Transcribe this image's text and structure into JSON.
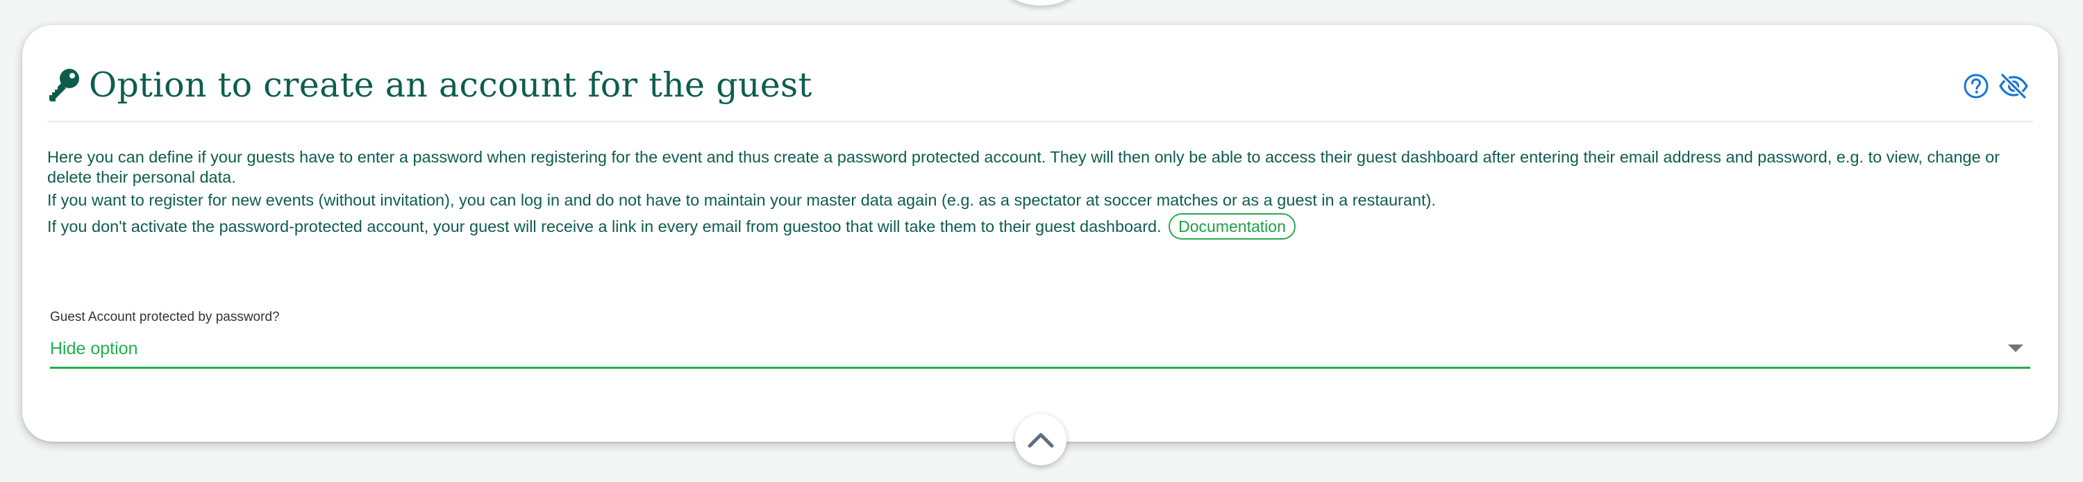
{
  "section": {
    "title": "Option to create an account for the guest",
    "title_icon": "key-icon",
    "actions": {
      "help_icon": "help-circle-icon",
      "visibility_icon": "eye-off-icon"
    }
  },
  "description": {
    "line1": "Here you can define if your guests have to enter a password when registering for the event and thus create a password protected account. They will then only be able to access their guest dashboard after entering their email address and password, e.g. to view, change or delete their personal data.",
    "line2": "If you want to register for new events (without invitation), you can log in and do not have to maintain your master data again (e.g. as a spectator at soccer matches or as a guest in a restaurant).",
    "line3": "If you don't activate the password-protected account, your guest will receive a link in every email from guestoo that will take them to their guest dashboard.",
    "documentation_label": "Documentation"
  },
  "field": {
    "label": "Guest Account protected by password?",
    "selected_value": "Hide option",
    "dropdown_icon": "caret-down-icon"
  },
  "footer": {
    "collapse_icon": "chevron-up-icon"
  },
  "colors": {
    "title_green": "#0d5d4e",
    "accent_green": "#22b14c",
    "icon_blue": "#1976d2"
  }
}
